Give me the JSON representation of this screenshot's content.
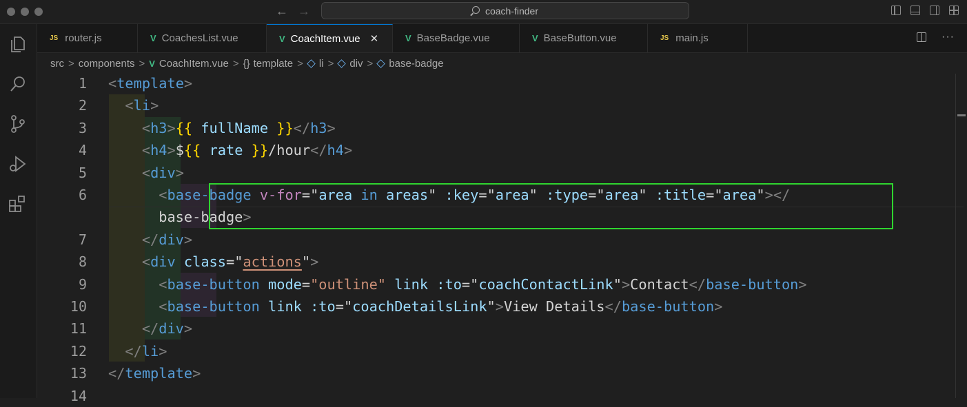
{
  "window": {
    "search_text": "coach-finder"
  },
  "tabs": [
    {
      "label": "router.js",
      "kind": "js",
      "active": false
    },
    {
      "label": "CoachesList.vue",
      "kind": "vue",
      "active": false
    },
    {
      "label": "CoachItem.vue",
      "kind": "vue",
      "active": true
    },
    {
      "label": "BaseBadge.vue",
      "kind": "vue",
      "active": false
    },
    {
      "label": "BaseButton.vue",
      "kind": "vue",
      "active": false
    },
    {
      "label": "main.js",
      "kind": "js",
      "active": false
    }
  ],
  "tab_icon_js": "JS",
  "tab_close": "✕",
  "breadcrumb": {
    "items": [
      "src",
      "components",
      "CoachItem.vue",
      "template",
      "li",
      "div",
      "base-badge"
    ],
    "separator": ">",
    "brace": "{}"
  },
  "editor": {
    "line_numbers": [
      "1",
      "2",
      "3",
      "4",
      "5",
      "6",
      "7",
      "8",
      "9",
      "10",
      "11",
      "12",
      "13",
      "14"
    ],
    "lines": [
      "<template>",
      "  <li>",
      "    <h3>{{ fullName }}</h3>",
      "    <h4>${{ rate }}/hour</h4>",
      "    <div>",
      "      <base-badge v-for=\"area in areas\" :key=\"area\" :type=\"area\" :title=\"area\"></",
      "      base-badge>",
      "    </div>",
      "    <div class=\"actions\">",
      "      <base-button mode=\"outline\" link :to=\"coachContactLink\">Contact</base-button>",
      "      <base-button link :to=\"coachDetailsLink\">View Details</base-button>",
      "    </div>",
      "  </li>",
      "</template>"
    ]
  },
  "colors": {
    "accent": "#0078d4",
    "highlight": "#2fd52f",
    "vue": "#41b883",
    "js": "#e2c44a"
  }
}
